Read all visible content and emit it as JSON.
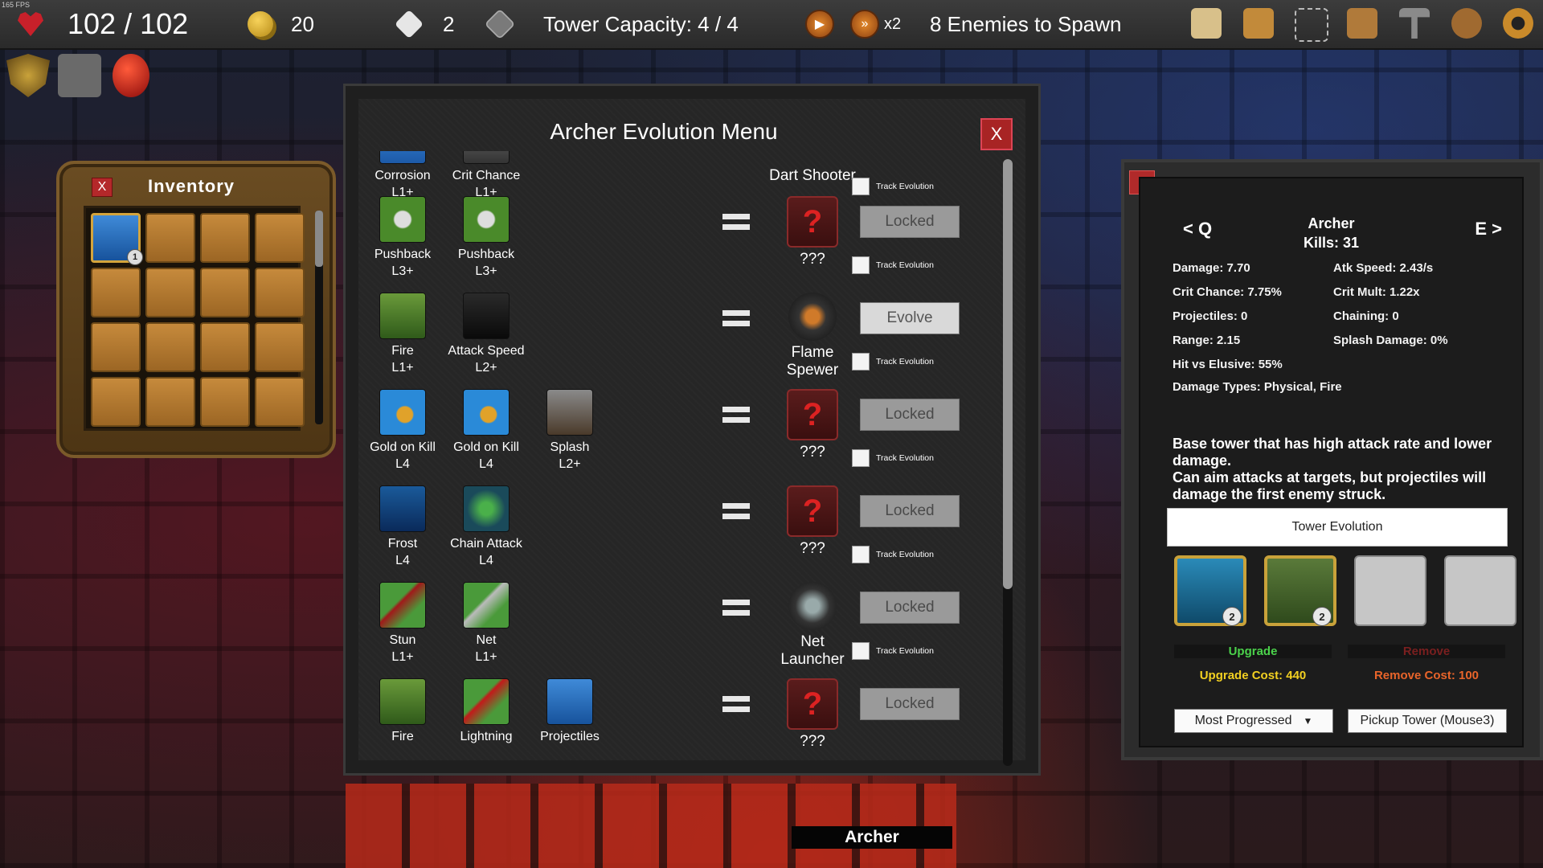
{
  "hud": {
    "fps": "165 FPS",
    "health": "102 / 102",
    "gold": "20",
    "dice": "2",
    "capacity": "Tower Capacity: 4 / 4",
    "speed": "x2",
    "enemies": "8 Enemies to Spawn"
  },
  "inventory": {
    "title": "Inventory",
    "close": "X",
    "first_slot_count": "1"
  },
  "menu": {
    "title": "Archer Evolution Menu",
    "close": "X",
    "track_label": "Track Evolution",
    "rows": [
      {
        "ingredients": [
          [
            "Corrosion",
            "L1+"
          ],
          [
            "Crit Chance",
            "L1+"
          ]
        ],
        "result": "Dart Shooter",
        "action": ""
      },
      {
        "ingredients": [
          [
            "Pushback",
            "L3+"
          ],
          [
            "Pushback",
            "L3+"
          ]
        ],
        "result": "???",
        "action": "Locked"
      },
      {
        "ingredients": [
          [
            "Fire",
            "L1+"
          ],
          [
            "Attack Speed",
            "L2+"
          ]
        ],
        "result": "Flame Spewer",
        "action": "Evolve"
      },
      {
        "ingredients": [
          [
            "Gold on Kill",
            "L4"
          ],
          [
            "Gold on Kill",
            "L4"
          ],
          [
            "Splash",
            "L2+"
          ]
        ],
        "result": "???",
        "action": "Locked"
      },
      {
        "ingredients": [
          [
            "Frost",
            "L4"
          ],
          [
            "Chain Attack",
            "L4"
          ]
        ],
        "result": "???",
        "action": "Locked"
      },
      {
        "ingredients": [
          [
            "Stun",
            "L1+"
          ],
          [
            "Net",
            "L1+"
          ]
        ],
        "result": "Net Launcher",
        "action": "Locked"
      },
      {
        "ingredients": [
          [
            "Fire",
            ""
          ],
          [
            "Lightning",
            ""
          ],
          [
            "Projectiles",
            ""
          ]
        ],
        "result": "???",
        "action": "Locked"
      }
    ]
  },
  "tower": {
    "back": "<",
    "prev": "< Q",
    "next": "E >",
    "name": "Archer",
    "kills": "Kills: 31",
    "stats_left": [
      "Damage: 7.70",
      "Crit Chance: 7.75%",
      "Projectiles: 0",
      "Range: 2.15",
      "Hit vs Elusive: 55%",
      "Damage Types: Physical, Fire"
    ],
    "stats_right": [
      "Atk Speed: 2.43/s",
      "Crit Mult: 1.22x",
      "Chaining: 0",
      "Splash Damage: 0%"
    ],
    "description": "Base tower that has high attack rate and lower damage.\nCan aim attacks at targets, but projectiles will damage the first enemy struck.",
    "evolution_button": "Tower Evolution",
    "slot1_count": "2",
    "slot2_count": "2",
    "upgrade": "Upgrade",
    "remove": "Remove",
    "upgrade_cost": "Upgrade Cost: 440",
    "remove_cost": "Remove Cost: 100",
    "targeting": "Most Progressed",
    "pickup": "Pickup Tower (Mouse3)"
  },
  "selected_label": "Archer"
}
